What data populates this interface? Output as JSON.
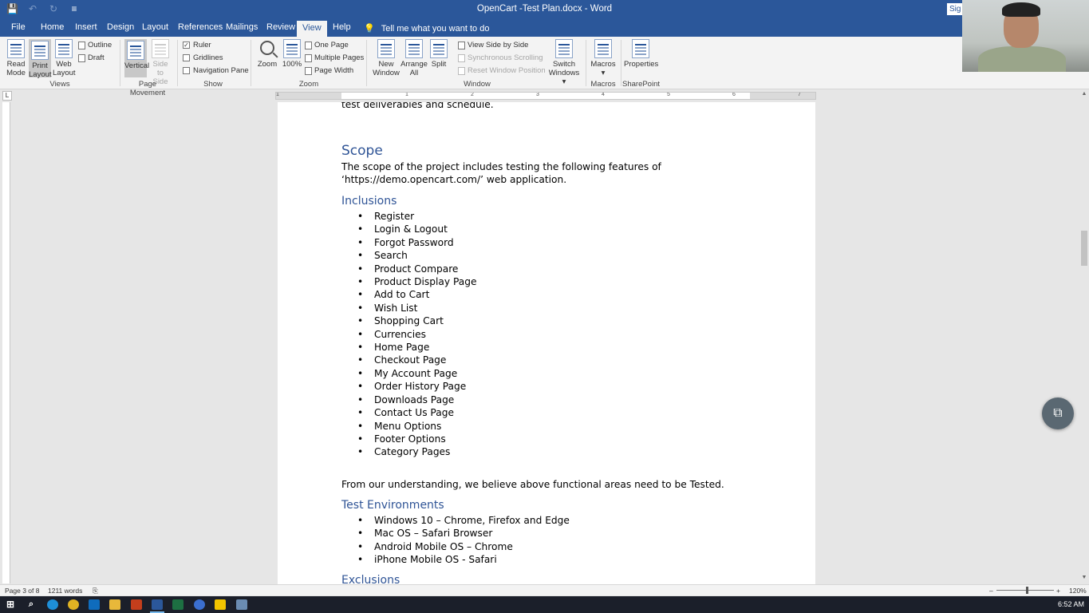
{
  "window": {
    "title": "OpenCart -Test Plan.docx  -  Word",
    "signin": "Sig",
    "qat": {
      "save_icon": "💾",
      "undo_icon": "↶",
      "redo_icon": "↻",
      "customize_icon": "≡"
    }
  },
  "tabs": [
    "File",
    "Home",
    "Insert",
    "Design",
    "Layout",
    "References",
    "Mailings",
    "Review",
    "View",
    "Help"
  ],
  "active_tab": "View",
  "tellme": {
    "icon": "💡",
    "text": "Tell me what you want to do"
  },
  "ribbon": {
    "views": {
      "group": "Views",
      "read_mode": [
        "Read",
        "Mode"
      ],
      "print_layout": [
        "Print",
        "Layout"
      ],
      "web_layout": [
        "Web",
        "Layout"
      ],
      "outline": "Outline",
      "draft": "Draft"
    },
    "page_movement": {
      "group": "Page Movement",
      "vertical": "Vertical",
      "side_to_side": [
        "Side",
        "to Side"
      ]
    },
    "show": {
      "group": "Show",
      "ruler": "Ruler",
      "gridlines": "Gridlines",
      "navigation_pane": "Navigation Pane",
      "check_mark": "✓"
    },
    "zoom": {
      "group": "Zoom",
      "zoom": "Zoom",
      "hundred": "100%",
      "one_page": "One Page",
      "multiple_pages": "Multiple Pages",
      "page_width": "Page Width"
    },
    "window": {
      "group": "Window",
      "new_window": [
        "New",
        "Window"
      ],
      "arrange_all": [
        "Arrange",
        "All"
      ],
      "split": "Split",
      "view_side_by_side": "View Side by Side",
      "sync_scrolling": "Synchronous Scrolling",
      "reset_position": "Reset Window Position",
      "switch_windows": [
        "Switch",
        "Windows ▾"
      ]
    },
    "macros": {
      "group": "Macros",
      "label": "Macros",
      "arrow": "▾"
    },
    "sharepoint": {
      "group": "SharePoint",
      "label": "Properties"
    }
  },
  "ruler": {
    "corner": "L",
    "numbers": [
      "1",
      "1",
      "2",
      "3",
      "4",
      "5",
      "6",
      "7"
    ]
  },
  "document": {
    "top_cut": "test deliverables and schedule.",
    "scope_heading": "Scope",
    "scope_line1": "The scope of the project includes testing the following features of",
    "scope_line2": "‘https://demo.opencart.com/’ web application.",
    "inclusions_heading": "Inclusions",
    "inclusions": [
      "Register",
      "Login & Logout",
      "Forgot Password",
      "Search",
      "Product Compare",
      "Product Display Page",
      "Add to Cart",
      "Wish List",
      "Shopping Cart",
      "Currencies",
      "Home Page",
      "Checkout Page",
      "My Account Page",
      "Order History Page",
      "Downloads Page",
      "Contact Us Page",
      "Menu Options",
      "Footer Options",
      "Category Pages"
    ],
    "understanding": "From our understanding, we believe above functional areas need to be Tested.",
    "env_heading": "Test Environments",
    "environments": [
      "Windows 10 – Chrome, Firefox and Edge",
      "Mac OS – Safari Browser",
      "Android Mobile OS – Chrome",
      "iPhone Mobile OS - Safari"
    ],
    "exclusions_heading": "Exclusions"
  },
  "scrollbar": {
    "up": "▲",
    "down": "▼"
  },
  "float_button_icon": "⧉",
  "status": {
    "page": "Page 3 of 8",
    "words": "1211 words",
    "proof_icon": "⎘",
    "zoom_minus": "–",
    "zoom_plus": "+",
    "zoom": "120%"
  },
  "taskbar": {
    "time": "6:52 AM",
    "start_icon": "⊞",
    "search_icon": "⌕"
  },
  "colors": {
    "word_blue": "#2b579a",
    "heading_blue": "#2f5496",
    "ribbon_bg": "#f3f3f3"
  }
}
